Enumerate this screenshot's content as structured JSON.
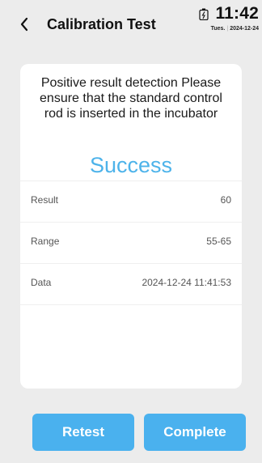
{
  "header": {
    "title": "Calibration Test",
    "back_icon": "chevron-left-icon"
  },
  "status": {
    "battery_icon": "battery-charging-icon",
    "time": "11:42",
    "day": "Tues.",
    "date": "2024-12-24"
  },
  "card": {
    "message": "Positive result detection Please ensure that the standard control rod is inserted in the incubator",
    "status_text": "Success",
    "status_color": "#4db3ea",
    "rows": [
      {
        "label": "Result",
        "value": "60"
      },
      {
        "label": "Range",
        "value": "55-65"
      },
      {
        "label": "Data",
        "value": "2024-12-24 11:41:53"
      }
    ]
  },
  "buttons": {
    "retest_label": "Retest",
    "complete_label": "Complete",
    "color": "#4ab1ee"
  }
}
